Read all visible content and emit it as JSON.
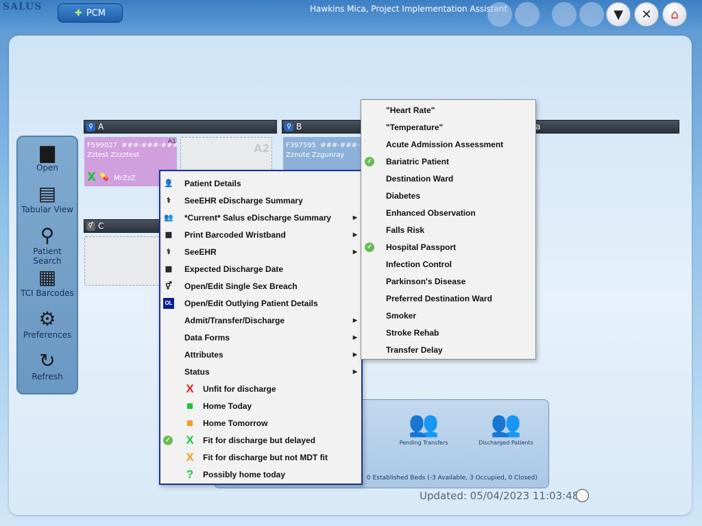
{
  "app": {
    "logo": "SALUS",
    "module": "PCM",
    "user": "Hawkins Mica, Project Implementation Assistant"
  },
  "toolbar": {
    "back": "←",
    "forward": "→",
    "exit": "⇲",
    "swap": "⇆",
    "filter": "▼",
    "close": "✕",
    "home": "⌂"
  },
  "sidebar": [
    {
      "label": "Open",
      "glyph": "▆"
    },
    {
      "label": "Tabular View",
      "glyph": "▤"
    },
    {
      "label": "Patient Search",
      "glyph": "⚲"
    },
    {
      "label": "TCI Barcodes",
      "glyph": "▦"
    },
    {
      "label": "Preferences",
      "glyph": "⚙"
    },
    {
      "label": "Refresh",
      "glyph": "↻"
    }
  ],
  "bays": [
    {
      "name": "A",
      "marker": "A"
    },
    {
      "name": "B",
      "marker": "B"
    },
    {
      "name": "C",
      "marker": "C"
    },
    {
      "name": "a",
      "marker": ""
    }
  ],
  "beds": {
    "a1": {
      "tag": "A1",
      "id": "F599027",
      "nhs": "###-###-####",
      "name": "Zztest Zzzztest",
      "consultant": "MrZzZ"
    },
    "a2": {
      "tag": "A2"
    },
    "b1": {
      "id": "F397595",
      "nhs": "###-###-####",
      "name": "Zznute Zzgunray"
    }
  },
  "context_menu": [
    {
      "label": "Patient Details",
      "icon": "person-icon",
      "glyph": "👤",
      "submenu": false
    },
    {
      "label": "SeeEHR eDischarge Summary",
      "icon": "seeehr-icon",
      "glyph": "⚕",
      "submenu": false
    },
    {
      "label": "*Current* Salus eDischarge Summary",
      "icon": "summary-icon",
      "glyph": "👥",
      "submenu": true
    },
    {
      "label": "Print Barcoded Wristband",
      "icon": "barcode-icon",
      "glyph": "▦",
      "submenu": true
    },
    {
      "label": "SeeEHR",
      "icon": "seeehr-icon",
      "glyph": "⚕",
      "submenu": true
    },
    {
      "label": "Expected Discharge Date",
      "icon": "calendar-icon",
      "glyph": "▦",
      "submenu": false
    },
    {
      "label": "Open/Edit Single Sex Breach",
      "icon": "gender-icon",
      "glyph": "⚥",
      "submenu": false
    },
    {
      "label": "Open/Edit Outlying Patient Details",
      "icon": "outlier-icon",
      "glyph": "OL",
      "submenu": false
    },
    {
      "label": "Admit/Transfer/Discharge",
      "submenu": true
    },
    {
      "label": "Data Forms",
      "submenu": true
    },
    {
      "label": "Attributes",
      "submenu": true
    },
    {
      "label": "Status",
      "submenu": true
    }
  ],
  "status_items": [
    {
      "label": "Unfit for discharge",
      "glyph": "X",
      "color": "#e11d1d",
      "checked": false
    },
    {
      "label": "Home Today",
      "glyph": "■",
      "color": "#1ec43a",
      "checked": false
    },
    {
      "label": "Home Tomorrow",
      "glyph": "■",
      "color": "#f59a2a",
      "checked": false
    },
    {
      "label": "Fit for discharge but delayed",
      "glyph": "X",
      "color": "#1ec43a",
      "checked": true
    },
    {
      "label": "Fit for discharge but not MDT fit",
      "glyph": "X",
      "color": "#f59a2a",
      "checked": false
    },
    {
      "label": "Possibly home today",
      "glyph": "?",
      "color": "#1ec43a",
      "checked": false
    }
  ],
  "attributes_menu": [
    {
      "label": "\"Heart Rate\"",
      "checked": false
    },
    {
      "label": "\"Temperature\"",
      "checked": false
    },
    {
      "label": "Acute Admission Assessment",
      "checked": false
    },
    {
      "label": "Bariatric Patient",
      "checked": true
    },
    {
      "label": "Destination Ward",
      "checked": false
    },
    {
      "label": "Diabetes",
      "checked": false
    },
    {
      "label": "Enhanced Observation",
      "checked": false
    },
    {
      "label": "Falls Risk",
      "checked": false
    },
    {
      "label": "Hospital Passport",
      "checked": true
    },
    {
      "label": "Infection Control",
      "checked": false
    },
    {
      "label": "Parkinson's Disease",
      "checked": false
    },
    {
      "label": "Preferred Destination Ward",
      "checked": false
    },
    {
      "label": "Smoker",
      "checked": false
    },
    {
      "label": "Stroke Rehab",
      "checked": false
    },
    {
      "label": "Transfer Delay",
      "checked": false
    }
  ],
  "lower_panel": {
    "pending": "Pending Transfers",
    "discharged": "Discharged Patients",
    "beds_summary": "0 Established Beds (-3 Available, 3 Occupied, 0 Closed)"
  },
  "status_bar": {
    "updated": "Updated: 05/04/2023 11:03:48"
  },
  "colors": {
    "accent": "#1a2f9a",
    "check": "#6bbb55",
    "occupied_bed": "#cf9fde"
  }
}
